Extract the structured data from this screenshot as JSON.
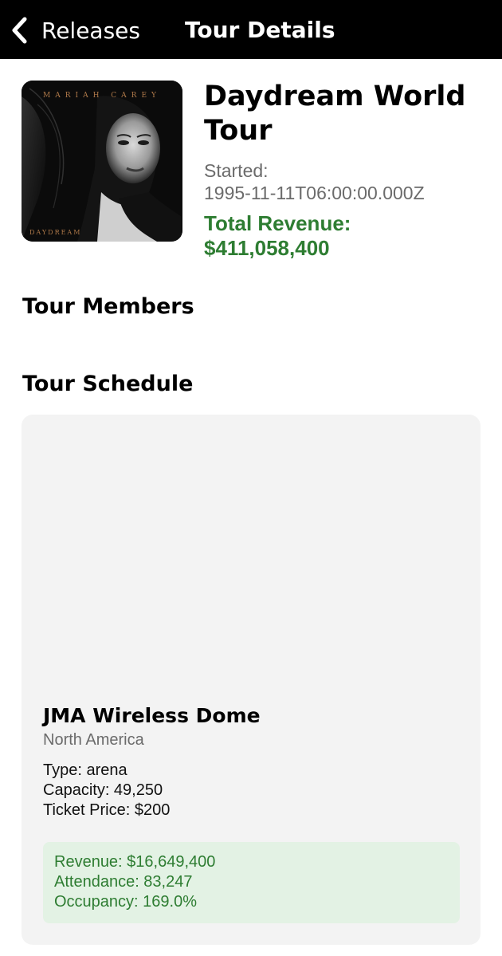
{
  "navbar": {
    "back_label": "Releases",
    "title": "Tour Details"
  },
  "tour": {
    "title": "Daydream World Tour",
    "started_label": "Started:",
    "started_value": "1995-11-11T06:00:00.000Z",
    "revenue_label": "Total Revenue:",
    "revenue_value": "$411,058,400",
    "revenue_color": "#2e7d32"
  },
  "album_cover": {
    "artist_text": "MARIAH CAREY",
    "album_text": "DAYDREAM"
  },
  "sections": {
    "members_heading": "Tour Members",
    "schedule_heading": "Tour Schedule"
  },
  "schedule": [
    {
      "venue": "JMA Wireless Dome",
      "region": "North America",
      "type": "Type: arena",
      "capacity": "Capacity: 49,250",
      "ticket_price": "Ticket Price: $200",
      "revenue": "Revenue: $16,649,400",
      "attendance": "Attendance: 83,247",
      "occupancy": "Occupancy: 169.0%"
    }
  ],
  "icons": {
    "back": "chevron-left-icon"
  }
}
